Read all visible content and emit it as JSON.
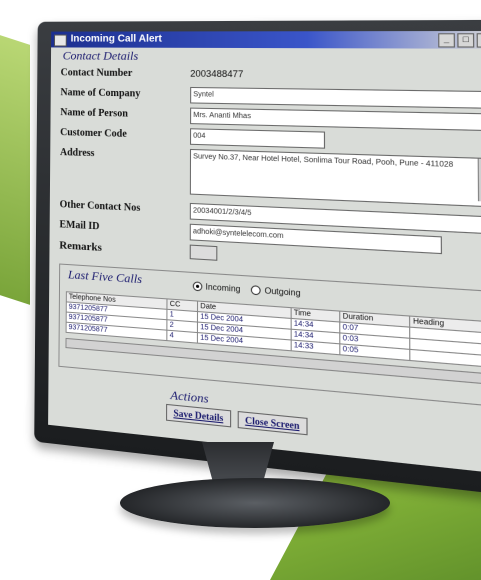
{
  "window": {
    "title": "Incoming Call Alert",
    "controls": [
      "_",
      "□",
      "x"
    ]
  },
  "contact": {
    "section_title": "Contact Details",
    "contact_number": {
      "label": "Contact Number",
      "value": "2003488477"
    },
    "company": {
      "label": "Name of Company",
      "value": "Syntel"
    },
    "person": {
      "label": "Name of Person",
      "value": "Mrs. Ananti Mhas"
    },
    "customer_code": {
      "label": "Customer Code",
      "value": "004"
    },
    "address": {
      "label": "Address",
      "value": "Survey No.37, Near Hotel Hotel, Sonlima Tour Road, Pooh, Pune - 411028"
    },
    "other_contact": {
      "label": "Other Contact Nos",
      "value": "20034001/2/3/4/5"
    },
    "email": {
      "label": "EMail ID",
      "value": "adhoki@syntelelecom.com"
    },
    "remarks": {
      "label": "Remarks"
    }
  },
  "calls": {
    "section_title": "Last Five Calls",
    "radio_incoming": "Incoming",
    "radio_outgoing": "Outgoing",
    "headers": [
      "Telephone Nos",
      "CC",
      "Date",
      "Time",
      "Duration",
      "Heading"
    ],
    "rows": [
      [
        "9371205877",
        "1",
        "15 Dec 2004",
        "14:34",
        "0:07",
        ""
      ],
      [
        "9371205877",
        "2",
        "15 Dec 2004",
        "14:34",
        "0:03",
        ""
      ],
      [
        "9371205877",
        "4",
        "15 Dec 2004",
        "14:33",
        "0:05",
        ""
      ]
    ]
  },
  "actions": {
    "title": "Actions",
    "save_label": "Save Details",
    "close_label": "Close Screen"
  }
}
